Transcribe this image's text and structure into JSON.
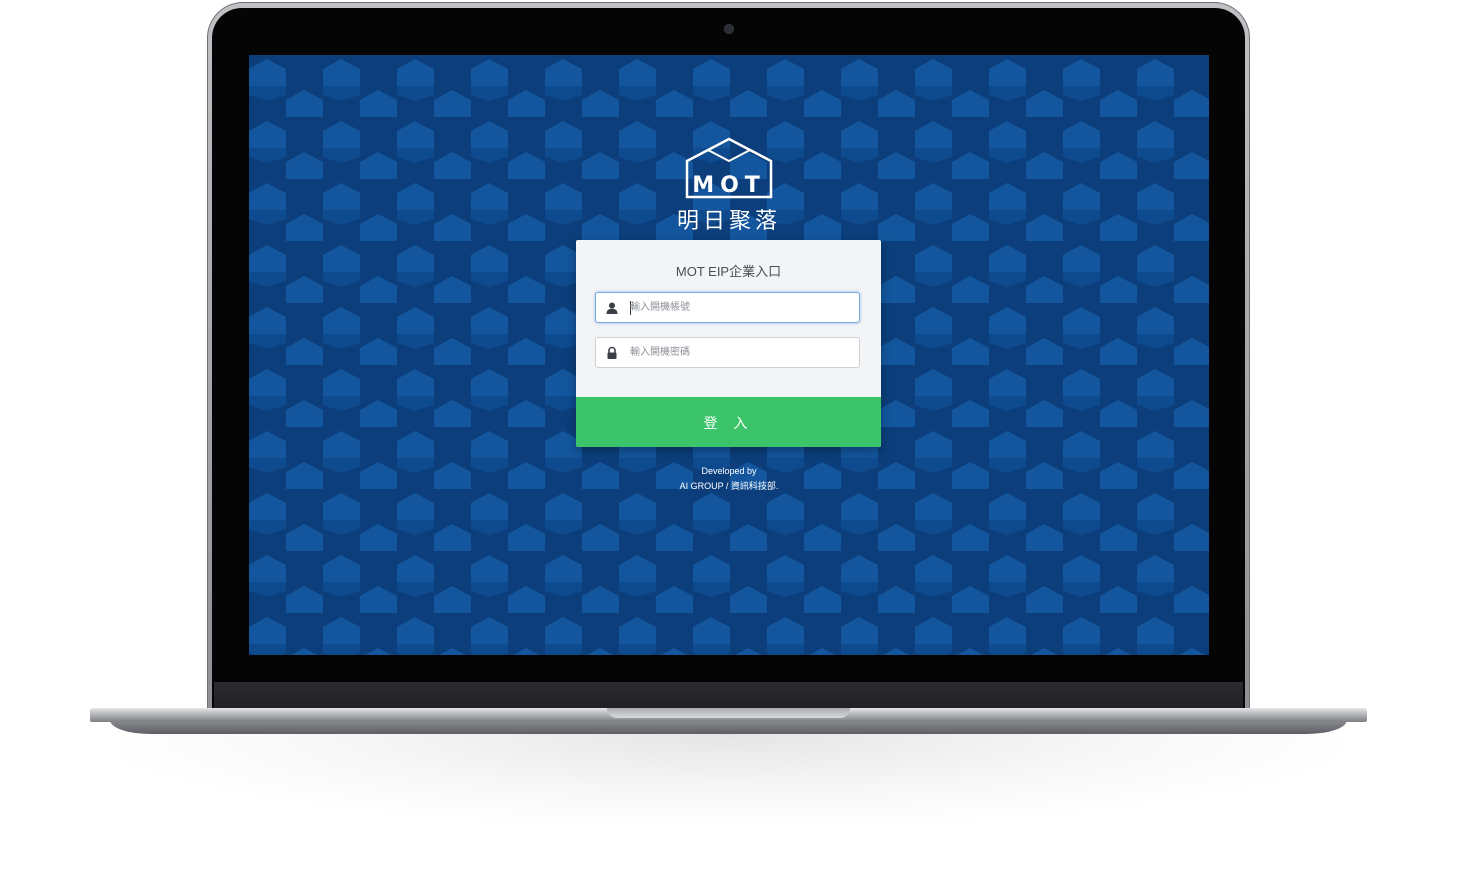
{
  "brand": {
    "logo_text": "MOT",
    "logo_cn": "明日聚落"
  },
  "login": {
    "title": "MOT EIP企業入口",
    "username_placeholder": "輸入開機帳號",
    "password_placeholder": "輸入開機密碼",
    "submit_label": "登 入"
  },
  "footer": {
    "line1": "Developed by",
    "line2": "AI GROUP / 資訊科技部."
  },
  "icons": {
    "username": "user-icon",
    "password": "lock-icon"
  },
  "colors": {
    "background": "#0b3e7b",
    "pattern_light": "#13569d",
    "button": "#3cc46a",
    "card": "#f3f4f6"
  }
}
